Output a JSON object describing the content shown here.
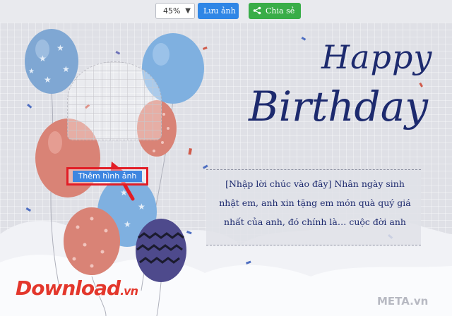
{
  "toolbar": {
    "zoom_value": "45%",
    "save_label": "Lưu ảnh",
    "share_label": "Chia sẻ"
  },
  "card": {
    "title_line1": "Happy",
    "title_line2": "Birthday",
    "message": "[Nhập lời chúc vào đây] Nhân ngày sinh nhật em, anh xin tặng em món quà quý giá nhất của anh, đó chính là… cuộc đời anh",
    "add_image_label": "Thêm hình ảnh"
  },
  "watermarks": {
    "download": "Download",
    "download_suffix": ".vn",
    "meta": "META.vn"
  },
  "colors": {
    "title": "#1d2a6e",
    "highlight_border": "#e21d26",
    "save_button": "#2f86e6",
    "share_button": "#39ad48"
  }
}
